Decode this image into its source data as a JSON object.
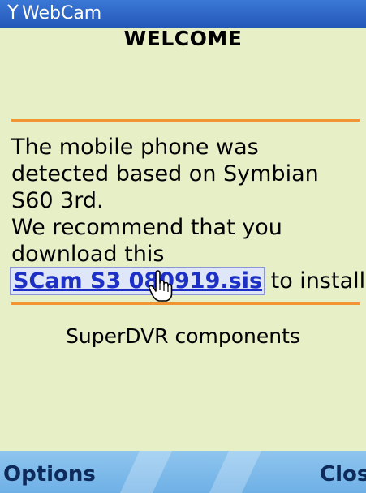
{
  "titlebar": {
    "title": "WebCam",
    "icon": "signal-antenna-icon"
  },
  "content": {
    "heading": "WELCOME",
    "message_lines": [
      "The mobile phone was",
      "detected based on Symbian",
      "S60 3rd.",
      "We recommend that you",
      "download this"
    ],
    "link_text": "SCam S3 080919.sis",
    "link_suffix": " to install.",
    "components_label": "SuperDVR components"
  },
  "softkeys": {
    "left_label": "Options",
    "right_label": "Close"
  },
  "colors": {
    "background": "#e6efc6",
    "titlebar": "#2f66c6",
    "divider": "#f29432",
    "link": "#1d2fc4",
    "softkey_bar": "#7fbbea"
  }
}
